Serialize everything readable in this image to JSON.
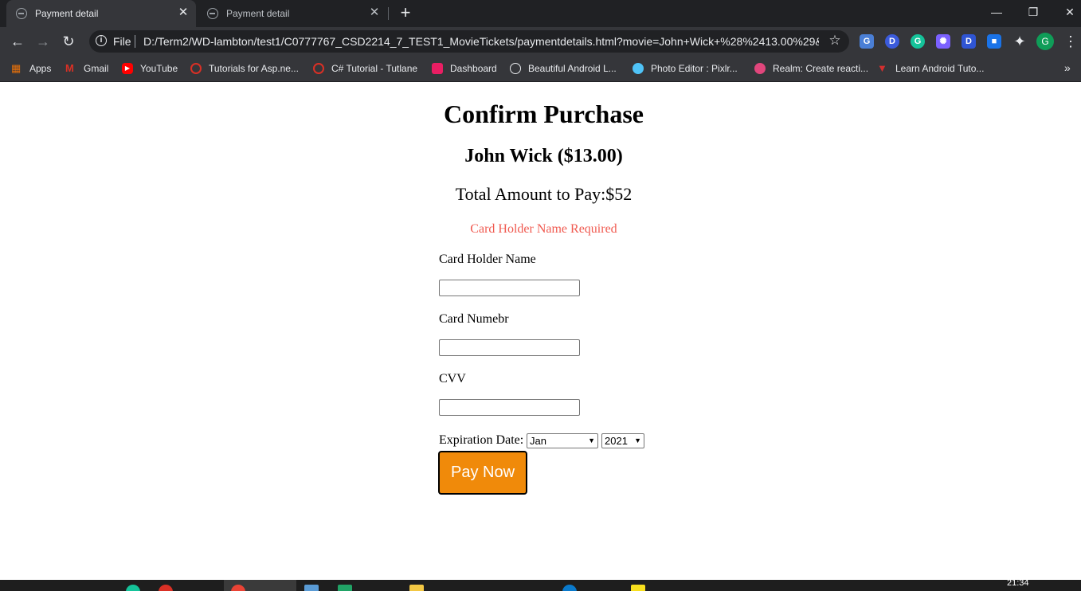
{
  "browser": {
    "tabs": [
      {
        "title": "Payment detail",
        "active": true
      },
      {
        "title": "Payment detail",
        "active": false
      }
    ],
    "window_controls": {
      "minimize": "—",
      "restore": "❐",
      "close": "✕"
    },
    "address_bar": {
      "scheme_label": "File",
      "url": "D:/Term2/WD-lambton/test1/C0777767_CSD2214_7_TEST1_MovieTickets/paymentdetails.html?movie=John+Wick+%28%2413.00%29&..."
    },
    "extensions": [
      {
        "name": "google-translate-extension-icon",
        "letter": "G",
        "color": "#4a7fd6"
      },
      {
        "name": "d-extension-icon",
        "letter": "D",
        "color": "#3b5bdb"
      },
      {
        "name": "grammarly-extension-icon",
        "letter": "G",
        "color": "#15c39a"
      },
      {
        "name": "color-extension-icon",
        "letter": "✺",
        "color": "#7b61ff"
      },
      {
        "name": "d2-extension-icon",
        "letter": "D",
        "color": "#2f55d4"
      },
      {
        "name": "screen-extension-icon",
        "letter": "■",
        "color": "#1a73e8"
      }
    ],
    "profile_initial": "G",
    "bookmarks": [
      {
        "label": "Apps",
        "color": "#e8710a"
      },
      {
        "label": "Gmail",
        "color": "#d93025"
      },
      {
        "label": "YouTube",
        "color": "#ff0000"
      },
      {
        "label": "Tutorials for Asp.ne...",
        "color": "#d93025"
      },
      {
        "label": "C# Tutorial - Tutlane",
        "color": "#d93025"
      },
      {
        "label": "Dashboard",
        "color": "#e91e63"
      },
      {
        "label": "Beautiful Android L...",
        "color": "#9aa0a6"
      },
      {
        "label": "Photo Editor : Pixlr...",
        "color": "#4fc3f7"
      },
      {
        "label": "Realm: Create reacti...",
        "color": "#e1467c"
      },
      {
        "label": "Learn Android Tuto...",
        "color": "#d32f2f"
      }
    ],
    "bookmarks_overflow": "»"
  },
  "page": {
    "heading": "Confirm Purchase",
    "movie": "John Wick ($13.00)",
    "total": "Total Amount to Pay:$52",
    "error": "Card Holder Name Required",
    "fields": {
      "card_holder_label": "Card Holder Name",
      "card_number_label": "Card Numebr",
      "cvv_label": "CVV",
      "expiration_label": "Expiration Date:",
      "month_selected": "Jan",
      "year_selected": "2021"
    },
    "pay_button": "Pay Now"
  },
  "taskbar": {
    "clock": "21:34"
  }
}
